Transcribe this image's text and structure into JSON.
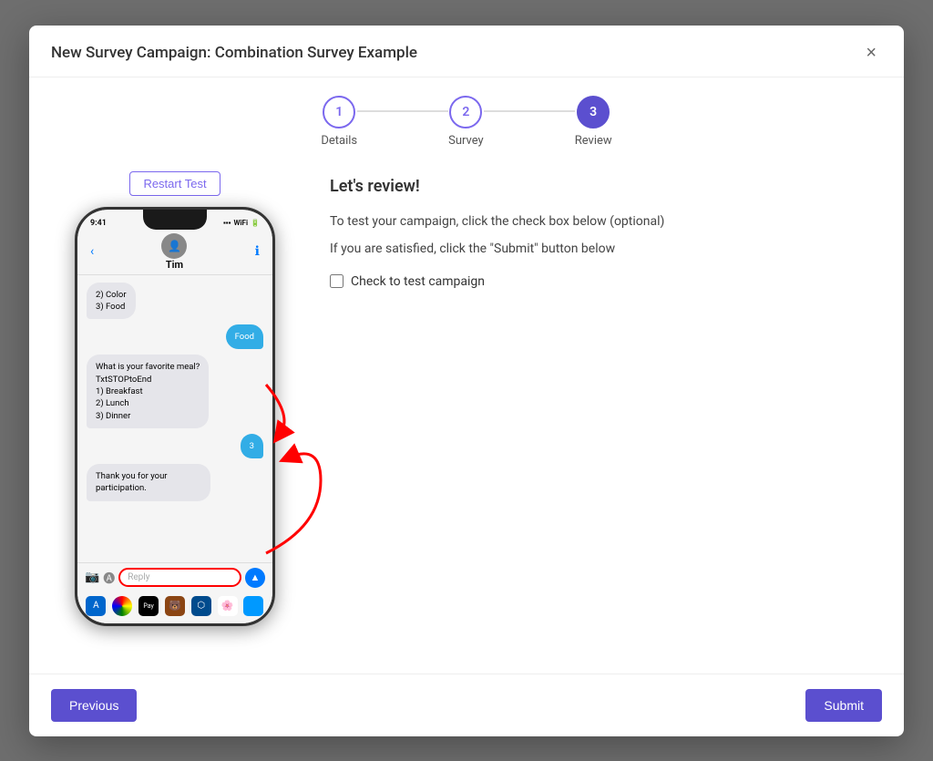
{
  "modal": {
    "title": "New Survey Campaign: Combination Survey Example",
    "close_label": "×"
  },
  "steps": [
    {
      "number": "1",
      "label": "Details",
      "state": "inactive"
    },
    {
      "number": "2",
      "label": "Survey",
      "state": "inactive"
    },
    {
      "number": "3",
      "label": "Review",
      "state": "active"
    }
  ],
  "phone": {
    "status_time": "9:41",
    "contact_name": "Tim",
    "messages": [
      {
        "type": "incoming",
        "text": "2) Color\n3) Food"
      },
      {
        "type": "outgoing",
        "text": "Food"
      },
      {
        "type": "incoming",
        "text": "What is your favorite meal?\nTxtSTOPtoEnd\n1) Breakfast\n2) Lunch\n3) Dinner"
      },
      {
        "type": "outgoing",
        "text": "3"
      },
      {
        "type": "incoming",
        "text": "Thank you for your participation."
      }
    ],
    "input_placeholder": "Reply",
    "restart_btn": "Restart Test"
  },
  "review": {
    "title": "Let's review!",
    "instructions": [
      "To test your campaign, click the check box below (optional)",
      "If you are satisfied, click the \"Submit\" button below"
    ],
    "check_label": "Check to test campaign"
  },
  "footer": {
    "previous_label": "Previous",
    "submit_label": "Submit"
  }
}
